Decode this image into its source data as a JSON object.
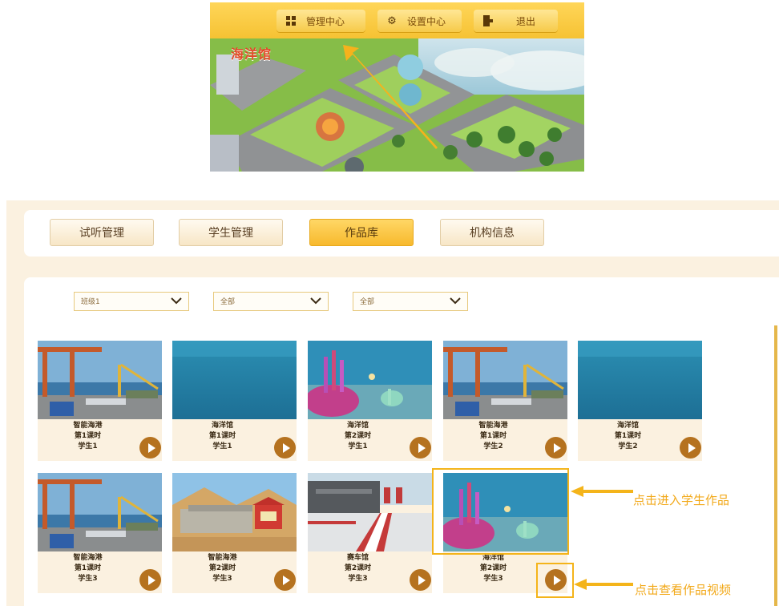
{
  "top_screenshot": {
    "buttons": [
      {
        "label": "管理中心",
        "icon": "grid-icon"
      },
      {
        "label": "设置中心",
        "icon": "gear-icon"
      },
      {
        "label": "退出",
        "icon": "exit-door-icon"
      }
    ],
    "scene_title": "海洋馆"
  },
  "tabs": [
    {
      "label": "试听管理",
      "active": false
    },
    {
      "label": "学生管理",
      "active": false
    },
    {
      "label": "作品库",
      "active": true
    },
    {
      "label": "机构信息",
      "active": false
    }
  ],
  "filters": [
    {
      "value": "班级1"
    },
    {
      "value": "全部"
    },
    {
      "value": "全部"
    }
  ],
  "works": [
    {
      "line1": "智能海港",
      "line2": "第1课时",
      "line3": "学生1",
      "thumb": "harbor"
    },
    {
      "line1": "海洋馆",
      "line2": "第1课时",
      "line3": "学生1",
      "thumb": "ocean"
    },
    {
      "line1": "海洋馆",
      "line2": "第2课时",
      "line3": "学生1",
      "thumb": "reef"
    },
    {
      "line1": "智能海港",
      "line2": "第1课时",
      "line3": "学生2",
      "thumb": "harbor"
    },
    {
      "line1": "海洋馆",
      "line2": "第1课时",
      "line3": "学生2",
      "thumb": "ocean"
    },
    {
      "line1": "智能海港",
      "line2": "第1课时",
      "line3": "学生3",
      "thumb": "harbor"
    },
    {
      "line1": "智能海港",
      "line2": "第2课时",
      "line3": "学生3",
      "thumb": "desert"
    },
    {
      "line1": "赛车馆",
      "line2": "第2课时",
      "line3": "学生3",
      "thumb": "race"
    },
    {
      "line1": "海洋馆",
      "line2": "第2课时",
      "line3": "学生3",
      "thumb": "reef"
    }
  ],
  "annotations": {
    "enter_work": "点击进入学生作品",
    "view_video": "点击查看作品视频"
  },
  "colors": {
    "accent": "#f7b92d",
    "highlight": "#f4b41a",
    "play_button": "#b5721f",
    "panel_bg": "#fbf1e0"
  }
}
